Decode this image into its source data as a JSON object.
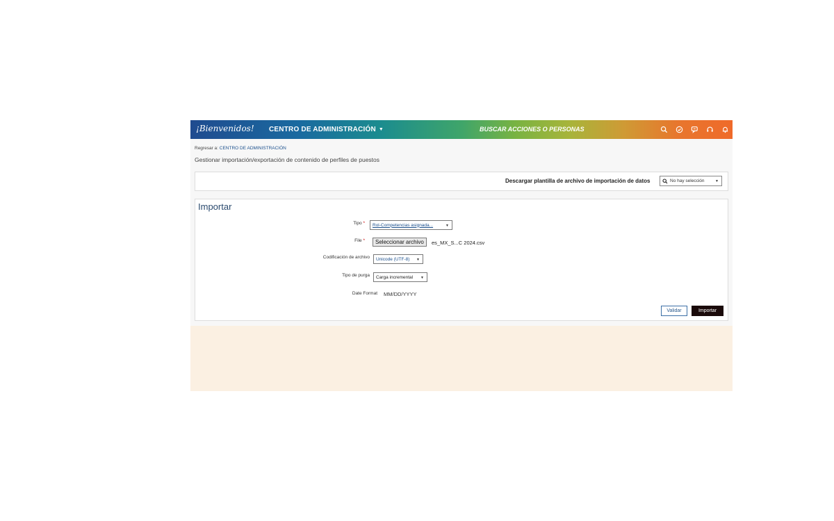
{
  "header": {
    "logo_text": "¡Bienvenidos!",
    "module_name": "CENTRO DE ADMINISTRACIÓN",
    "module_caret": "▼",
    "search_text": "BUSCAR ACCIONES O PERSONAS",
    "icons": [
      "search-icon",
      "check-circle-icon",
      "chat-icon",
      "headset-icon",
      "bell-icon"
    ]
  },
  "breadcrumb": {
    "prefix": "Regresar a: ",
    "link": "CENTRO DE ADMINISTRACIÓN"
  },
  "page_title": "Gestionar importación/exportación de contenido de perfiles de puestos",
  "download": {
    "label": "Descargar plantilla de archivo de importación de datos",
    "select_value": "No hay selección"
  },
  "import": {
    "title": "Importar",
    "tipo_label": "Tipo",
    "tipo_value": "Rol-Competencias asignada...",
    "file_label": "File",
    "file_button": "Seleccionar archivo",
    "file_name": "es_MX_S...C 2024.csv",
    "encoding_label": "Codificación de archivo",
    "encoding_value": "Unicode (UTF-8)",
    "purge_label": "Tipo de purga",
    "purge_value": "Carga incremental",
    "date_label": "Date Format",
    "date_value": "MM/DD/YYYY",
    "required_mark": "*",
    "validate_button": "Validar",
    "import_button": "Importar"
  },
  "colors": {
    "accent_dark": "#1a0a0a",
    "link_blue": "#1a4f8c",
    "required_red": "#cc0000",
    "bottom_area": "#fbf0e2"
  }
}
